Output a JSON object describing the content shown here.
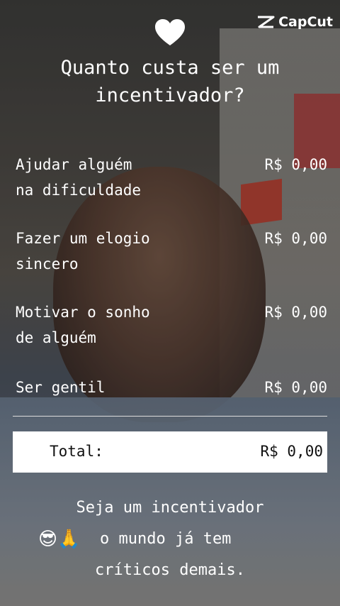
{
  "brand": {
    "name": "CapCut"
  },
  "title": {
    "line1": "Quanto custa ser um",
    "line2": "incentivador?"
  },
  "items": [
    {
      "line1": "Ajudar alguém",
      "line2": "na dificuldade",
      "price": "R$ 0,00"
    },
    {
      "line1": "Fazer um elogio",
      "line2": "sincero",
      "price": "R$ 0,00"
    },
    {
      "line1": "Motivar o sonho",
      "line2": "de alguém",
      "price": "R$ 0,00"
    },
    {
      "line1": "Ser gentil",
      "line2": "",
      "price": "R$ 0,00"
    }
  ],
  "total": {
    "label": "Total:",
    "value": "R$ 0,00"
  },
  "footer": {
    "line1": "Seja um incentivador",
    "emojis": "😎🙏",
    "line2": "o mundo já tem",
    "line3": "críticos demais."
  },
  "icons": [
    "heart-icon",
    "capcut-logo-icon",
    "sunglasses-emoji-icon",
    "praying-hands-emoji-icon"
  ]
}
